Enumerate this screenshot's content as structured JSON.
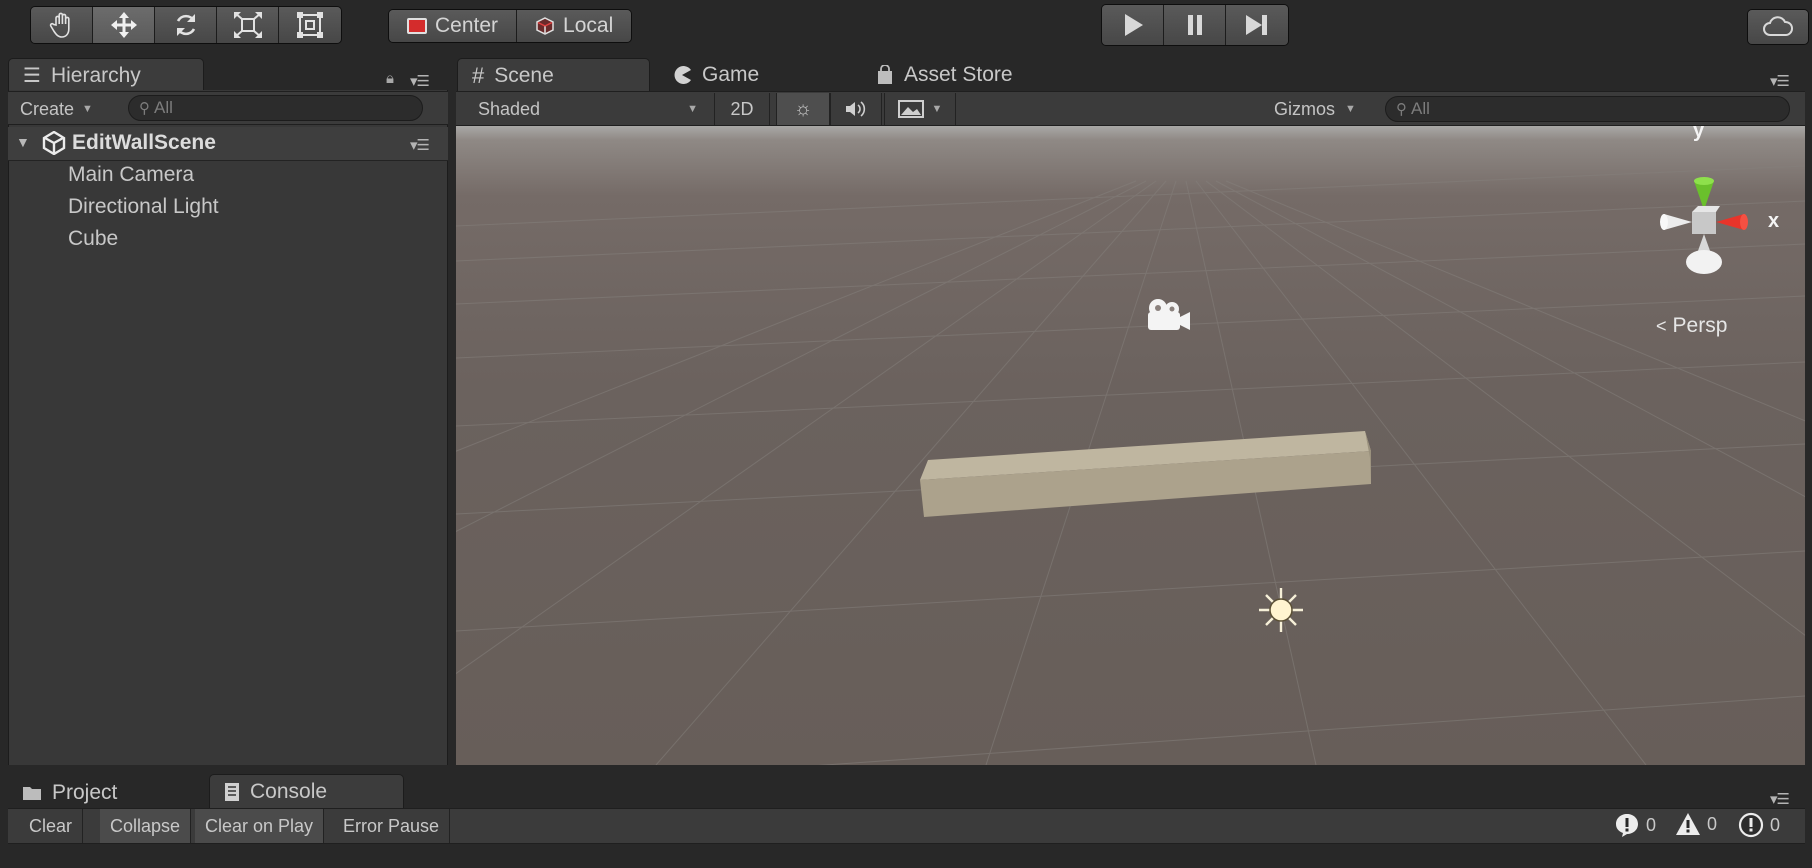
{
  "toolbar": {
    "tools": [
      "hand-tool",
      "move-tool",
      "rotate-tool",
      "scale-tool",
      "rect-tool"
    ],
    "pivot_center": "Center",
    "pivot_local": "Local",
    "play_controls": [
      "play",
      "pause",
      "step"
    ]
  },
  "hierarchy": {
    "tab_label": "Hierarchy",
    "create_label": "Create",
    "search_placeholder": "All",
    "scene_name": "EditWallScene",
    "items": [
      "Main Camera",
      "Directional Light",
      "Cube"
    ]
  },
  "scene": {
    "tabs": [
      {
        "label": "Scene",
        "icon": "grid-icon"
      },
      {
        "label": "Game",
        "icon": "pacman-icon"
      },
      {
        "label": "Asset Store",
        "icon": "store-bag-icon"
      }
    ],
    "shading_mode": "Shaded",
    "mode_2d": "2D",
    "gizmos_label": "Gizmos",
    "search_placeholder": "All",
    "gizmo_axis_y": "y",
    "gizmo_axis_x": "x",
    "projection": "Persp"
  },
  "console": {
    "tabs": [
      {
        "label": "Project",
        "icon": "folder-icon"
      },
      {
        "label": "Console",
        "icon": "console-icon"
      }
    ],
    "buttons": [
      "Clear",
      "Collapse",
      "Clear on Play",
      "Error Pause"
    ],
    "info_count": "0",
    "warning_count": "0",
    "error_count": "0"
  },
  "colors": {
    "background": "#282828",
    "panel": "#383838",
    "scene_floor": "#6b625e",
    "gizmo_x": "#e8342a",
    "gizmo_y": "#6ac02c",
    "gizmo_z": "#3b6de0",
    "cube": "#aca28c"
  }
}
